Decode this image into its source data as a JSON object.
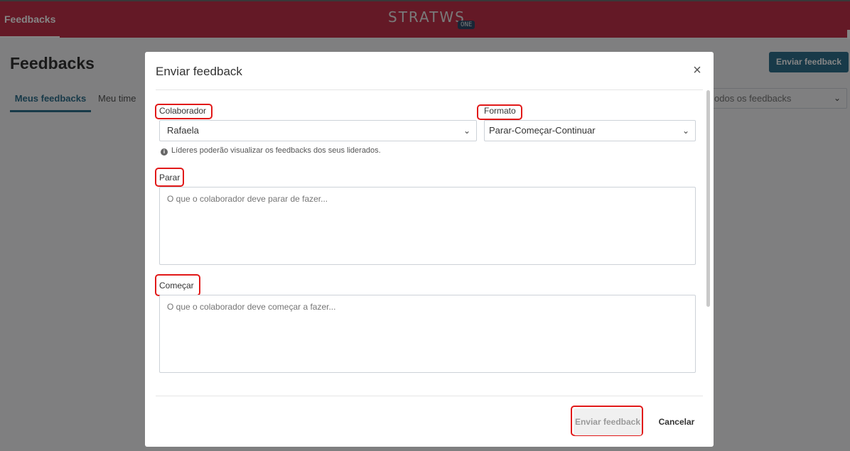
{
  "topbar": {
    "tab_label": "Feedbacks",
    "logo_text": "STRATWS",
    "logo_sub": "ONE",
    "color": "#c0314a"
  },
  "page": {
    "title": "Feedbacks",
    "cta_label": "Enviar feedback",
    "tabs": [
      {
        "label": "Meus feedbacks",
        "active": true
      },
      {
        "label": "Meu time",
        "active": false
      }
    ],
    "filter_value": "odos os feedbacks",
    "accent": "#2f6f8c"
  },
  "modal": {
    "title": "Enviar feedback",
    "close_icon": "close-icon",
    "colaborador": {
      "label": "Colaborador",
      "value": "Rafaela"
    },
    "formato": {
      "label": "Formato",
      "value": "Parar-Começar-Continuar"
    },
    "hint": "Líderes poderão visualizar os feedbacks dos seus liderados.",
    "parar": {
      "label": "Parar",
      "placeholder": "O que o colaborador deve parar de fazer..."
    },
    "comecar": {
      "label": "Começar",
      "placeholder": "O que o colaborador deve começar a fazer..."
    },
    "submit_label": "Enviar feedback",
    "cancel_label": "Cancelar",
    "highlight_color": "#e11919"
  }
}
